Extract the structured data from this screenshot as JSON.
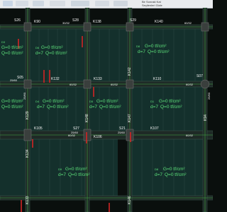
{
  "ribbon": {
    "items": [
      "Ribbon tool",
      "Ribbon tool",
      "Ribbon tool",
      "Ribbon tool",
      "Ribbon tool",
      "Ribbon tool"
    ],
    "right_text_1": "Bir Sonraki Kat",
    "right_text_2": "Seçilenleri Gizle"
  },
  "colors": {
    "background": "#0a0f0d",
    "slab": "#14302c",
    "beam": "#1e2a26",
    "column": "#3a3f3d",
    "red_marker": "#d22424",
    "green_text": "#5de07a",
    "white_text": "#f4f4f4",
    "axis_green": "#4fd04f"
  },
  "columns": [
    {
      "label": "S26"
    },
    {
      "label": "S28"
    },
    {
      "label": "S29"
    },
    {
      "label": "S30"
    },
    {
      "label": "S05"
    },
    {
      "label": "S07"
    },
    {
      "label": "S27"
    },
    {
      "label": "S21"
    }
  ],
  "beams": [
    {
      "label": "K90",
      "size": "30/32"
    },
    {
      "label": "K138",
      "size": "30/32"
    },
    {
      "label": "K140",
      "size": "60/32"
    },
    {
      "label": "K132",
      "size": "60/32"
    },
    {
      "label": "K133",
      "size": "60/32"
    },
    {
      "label": "K110",
      "size": "60/32"
    },
    {
      "label": "K105",
      "size": "60/32"
    },
    {
      "label": "K106",
      "size": "60/32"
    },
    {
      "label": "K107",
      "size": "60/32"
    },
    {
      "label": "K129",
      "size": "25/60"
    },
    {
      "label": "K148",
      "size": "25/60"
    },
    {
      "label": "K147",
      "size": "25/60"
    },
    {
      "label": "K94",
      "size": "25/60"
    },
    {
      "label": "K142",
      "size": "25/60"
    },
    {
      "label": "K134",
      "size": "25/60"
    },
    {
      "label": "K133",
      "size": "25/60"
    },
    {
      "label": "K146",
      "size": "25/60"
    }
  ],
  "slabs": [
    {
      "id": "D3",
      "thickness": "d=7",
      "load_line_1": "G=0 tf/cm²",
      "load_line_2": "Q=0 tf/cm²"
    },
    {
      "id": "D6",
      "thickness": "d=7",
      "load_line_1": "G=0 tf/cm²",
      "load_line_2": "Q=0 tf/cm²"
    },
    {
      "id": "D8",
      "thickness": "d=7",
      "load_line_1": "G=0 tf/cm²",
      "load_line_2": "Q=0 tf/cm²"
    },
    {
      "id": "D2",
      "thickness": "d=7",
      "load_line_1": "G=0 tf/cm²",
      "load_line_2": "Q=0 tf/cm²"
    },
    {
      "id": "D4",
      "thickness": "d=7",
      "load_line_1": "G=0 tf/cm²",
      "load_line_2": "Q=0 tf/cm²"
    },
    {
      "id": "D5",
      "thickness": "d=7",
      "load_line_1": "G=0 tf/cm²",
      "load_line_2": "Q=0 tf/cm²"
    },
    {
      "id": "D1",
      "thickness": "d=7",
      "load_line_1": "G=0 tf/cm²",
      "load_line_2": "Q=0 tf/cm²"
    },
    {
      "id": "D9",
      "thickness": "d=7",
      "load_line_1": "G=0 tf/cm²",
      "load_line_2": "Q=0 tf/cm²"
    }
  ],
  "column_sizes": [
    "25/60",
    "25/60",
    "25/60"
  ]
}
